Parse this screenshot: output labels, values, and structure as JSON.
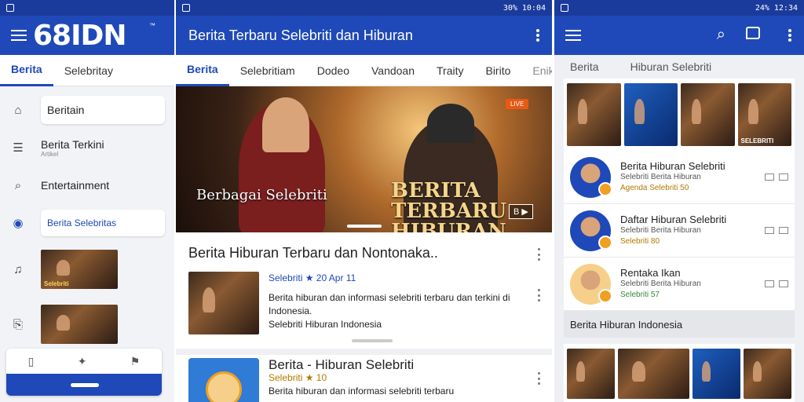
{
  "status_time_1": "",
  "status_right_2": "30% 10:04",
  "status_right_3": "24% 12:34",
  "phone1": {
    "logo": "68IDN",
    "tabs": [
      "Berita",
      "Selebritay"
    ],
    "sidebar": [
      {
        "label": "Beritain",
        "icon": "home-icon"
      },
      {
        "label": "Berita Terkini",
        "sub": "Artikel",
        "icon": "list-icon"
      },
      {
        "label": "Entertainment",
        "icon": "search-icon"
      },
      {
        "label": "Berita Selebritas",
        "icon": "target-icon"
      },
      {
        "label": "",
        "icon": "music-icon"
      },
      {
        "label": "",
        "icon": "bookmark-icon"
      }
    ],
    "thumb_caption": "Selebriti"
  },
  "phone2": {
    "title": "Berita Terbaru Selebriti dan Hiburan",
    "tabs": [
      "Berita",
      "Selebritiam",
      "Dodeo",
      "Vandoan",
      "Traity",
      "Birito",
      "Enik"
    ],
    "hero": {
      "badge": "LIVE",
      "title": "Berbagai Selebriti",
      "sub": "BERITA TERBARU HIBURAN",
      "tag": "B ▶"
    },
    "headline": "Berita Hiburan Terbaru dan Nontonaka..",
    "card1": {
      "meta": "Selebriti ★ 20 Apr 11",
      "body": "Berita hiburan dan informasi selebriti terbaru dan terkini di Indonesia.",
      "foot": "Selebriti Hiburan Indonesia"
    },
    "card2": {
      "title": "Berita - Hiburan Selebriti",
      "meta": "Selebriti ★ 10",
      "body": "Berita hiburan dan informasi selebriti terbaru"
    }
  },
  "phone3": {
    "tabs": [
      "Berita",
      "Hiburan Selebriti"
    ],
    "grid_caption": "SELEBRITI",
    "rows": [
      {
        "title": "Berita Hiburan Selebriti",
        "sub": "Selebriti Berita Hiburan",
        "meta": "Agenda Selebriti 50"
      },
      {
        "title": "Daftar Hiburan Selebriti",
        "sub": "Selebriti Berita Hiburan",
        "meta": "Selebriti 80"
      },
      {
        "title": "Rentaka Ikan",
        "sub": "Selebriti Berita Hiburan",
        "meta": "Selebriti 57"
      }
    ],
    "section": "Berita Hiburan Indonesia"
  }
}
